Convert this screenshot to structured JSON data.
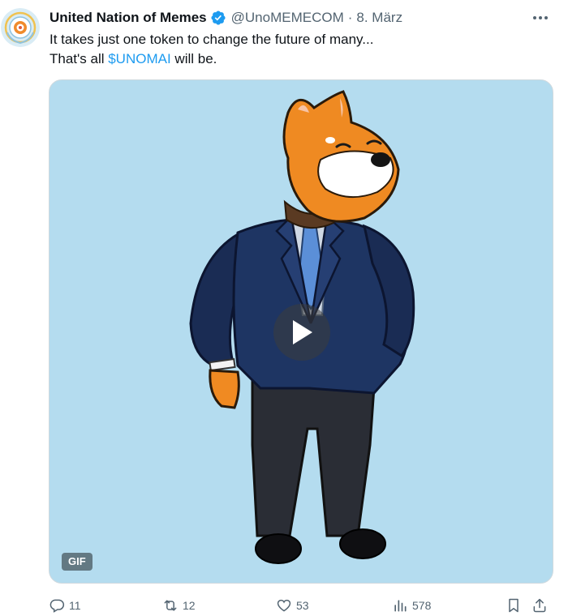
{
  "author": {
    "display_name": "United Nation of Memes",
    "verified": true,
    "handle": "@UnoMEMECOM",
    "separator": "·",
    "date": "8. März"
  },
  "tweet": {
    "line1": "It takes just one token to change the future of many...",
    "line2_prefix": "That's all ",
    "cashtag": "$UNOMAI",
    "line2_suffix": " will be."
  },
  "media": {
    "badge": "GIF",
    "background": "#b4dcef"
  },
  "actions": {
    "replies": "11",
    "reposts": "12",
    "likes": "53",
    "views": "578"
  },
  "colors": {
    "accent": "#1d9bf0",
    "muted": "#536471"
  },
  "icons": [
    "verified-badge-icon",
    "more-options-icon",
    "play-icon",
    "reply-icon",
    "repost-icon",
    "like-icon",
    "views-icon",
    "bookmark-icon",
    "share-icon"
  ]
}
